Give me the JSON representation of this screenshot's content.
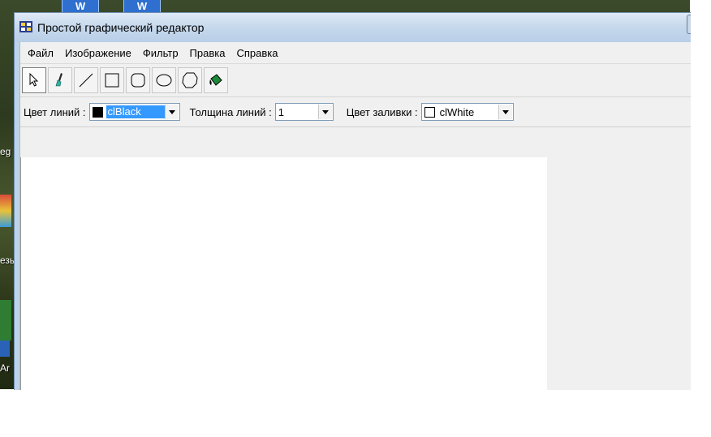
{
  "window": {
    "title": "Простой графический редактор"
  },
  "menu": [
    "Файл",
    "Изображение",
    "Фильтр",
    "Правка",
    "Справка"
  ],
  "tools": [
    {
      "name": "select-pointer-icon",
      "active": true
    },
    {
      "name": "brush-icon",
      "active": false
    },
    {
      "name": "line-icon",
      "active": false
    },
    {
      "name": "rectangle-icon",
      "active": false
    },
    {
      "name": "rounded-rectangle-icon",
      "active": false
    },
    {
      "name": "ellipse-icon",
      "active": false
    },
    {
      "name": "polygon-icon",
      "active": false
    },
    {
      "name": "fill-icon",
      "active": false
    }
  ],
  "properties": {
    "line_color_label": "Цвет линий :",
    "line_color_value": "clBlack",
    "line_color_hex": "#000000",
    "line_width_label": "Толщина линий :",
    "line_width_value": "1",
    "fill_color_label": "Цвет заливки :",
    "fill_color_value": "clWhite",
    "fill_color_hex": "#ffffff"
  },
  "desktop": {
    "top_icons": [
      "W",
      "W"
    ],
    "labels": [
      "eg",
      "езы",
      "Ar"
    ]
  },
  "colors": {
    "selection_highlight": "#3399ff",
    "canvas": "#ffffff"
  }
}
